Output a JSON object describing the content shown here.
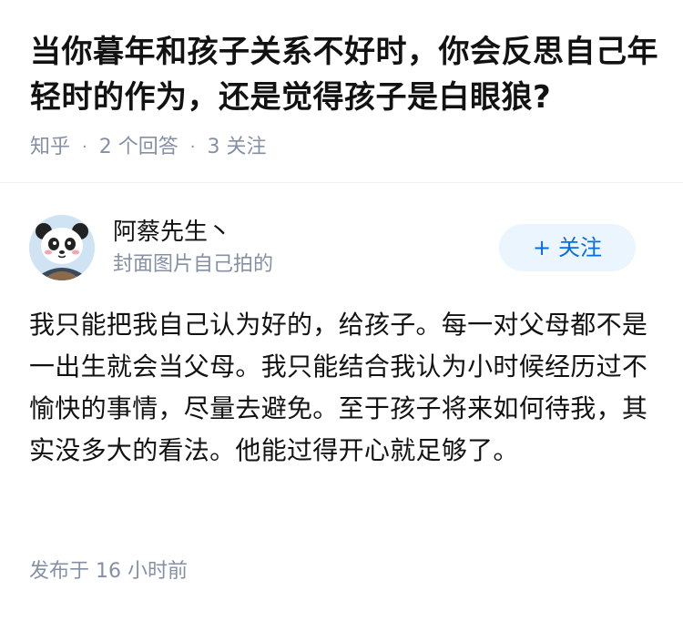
{
  "question": {
    "title": "当你暮年和孩子关系不好时，你会反思自己年轻时的作为，还是觉得孩子是白眼狼?",
    "source": "知乎",
    "answers_count": "2 个回答",
    "followers_count": "3 关注",
    "separator": "·"
  },
  "answer": {
    "author": {
      "name": "阿蔡先生丶",
      "bio": "封面图片自己拍的",
      "avatar_icon": "panda-avatar-icon"
    },
    "follow_button": {
      "plus": "+",
      "label": "关注"
    },
    "content": "我只能把我自己认为好的，给孩子。每一对父母都不是一出生就会当父母。我只能结合我认为小时候经历过不愉快的事情，尽量去避免。至于孩子将来如何待我，其实没多大的看法。他能过得开心就足够了。",
    "published_time": "发布于  16 小时前"
  },
  "colors": {
    "title": "#121212",
    "meta": "#8590a6",
    "accent": "#056de8",
    "follow_bg": "#ebf5fd"
  }
}
